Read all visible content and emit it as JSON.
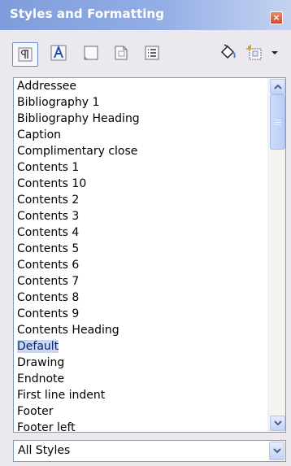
{
  "window": {
    "title": "Styles and Formatting",
    "close_label": "×"
  },
  "toolbar": {
    "buttons": [
      {
        "name": "paragraph-styles-icon",
        "active": true
      },
      {
        "name": "character-styles-icon"
      },
      {
        "name": "frame-styles-icon"
      },
      {
        "name": "page-styles-icon"
      },
      {
        "name": "list-styles-icon"
      },
      {
        "name": "fill-format-mode-icon"
      },
      {
        "name": "new-style-from-selection-icon"
      },
      {
        "name": "dropdown-arrow-icon"
      }
    ]
  },
  "style_list": {
    "items": [
      "Addressee",
      "Bibliography 1",
      "Bibliography Heading",
      "Caption",
      "Complimentary close",
      "Contents 1",
      "Contents 10",
      "Contents 2",
      "Contents 3",
      "Contents 4",
      "Contents 5",
      "Contents 6",
      "Contents 7",
      "Contents 8",
      "Contents 9",
      "Contents Heading",
      "Default",
      "Drawing",
      "Endnote",
      "First line indent",
      "Footer",
      "Footer left"
    ],
    "selected": "Default"
  },
  "filter": {
    "value": "All Styles"
  },
  "colors": {
    "titlebar": "#7f9ddb",
    "selection": "#c8d7f4",
    "panel_bg": "#ebe9ed"
  }
}
